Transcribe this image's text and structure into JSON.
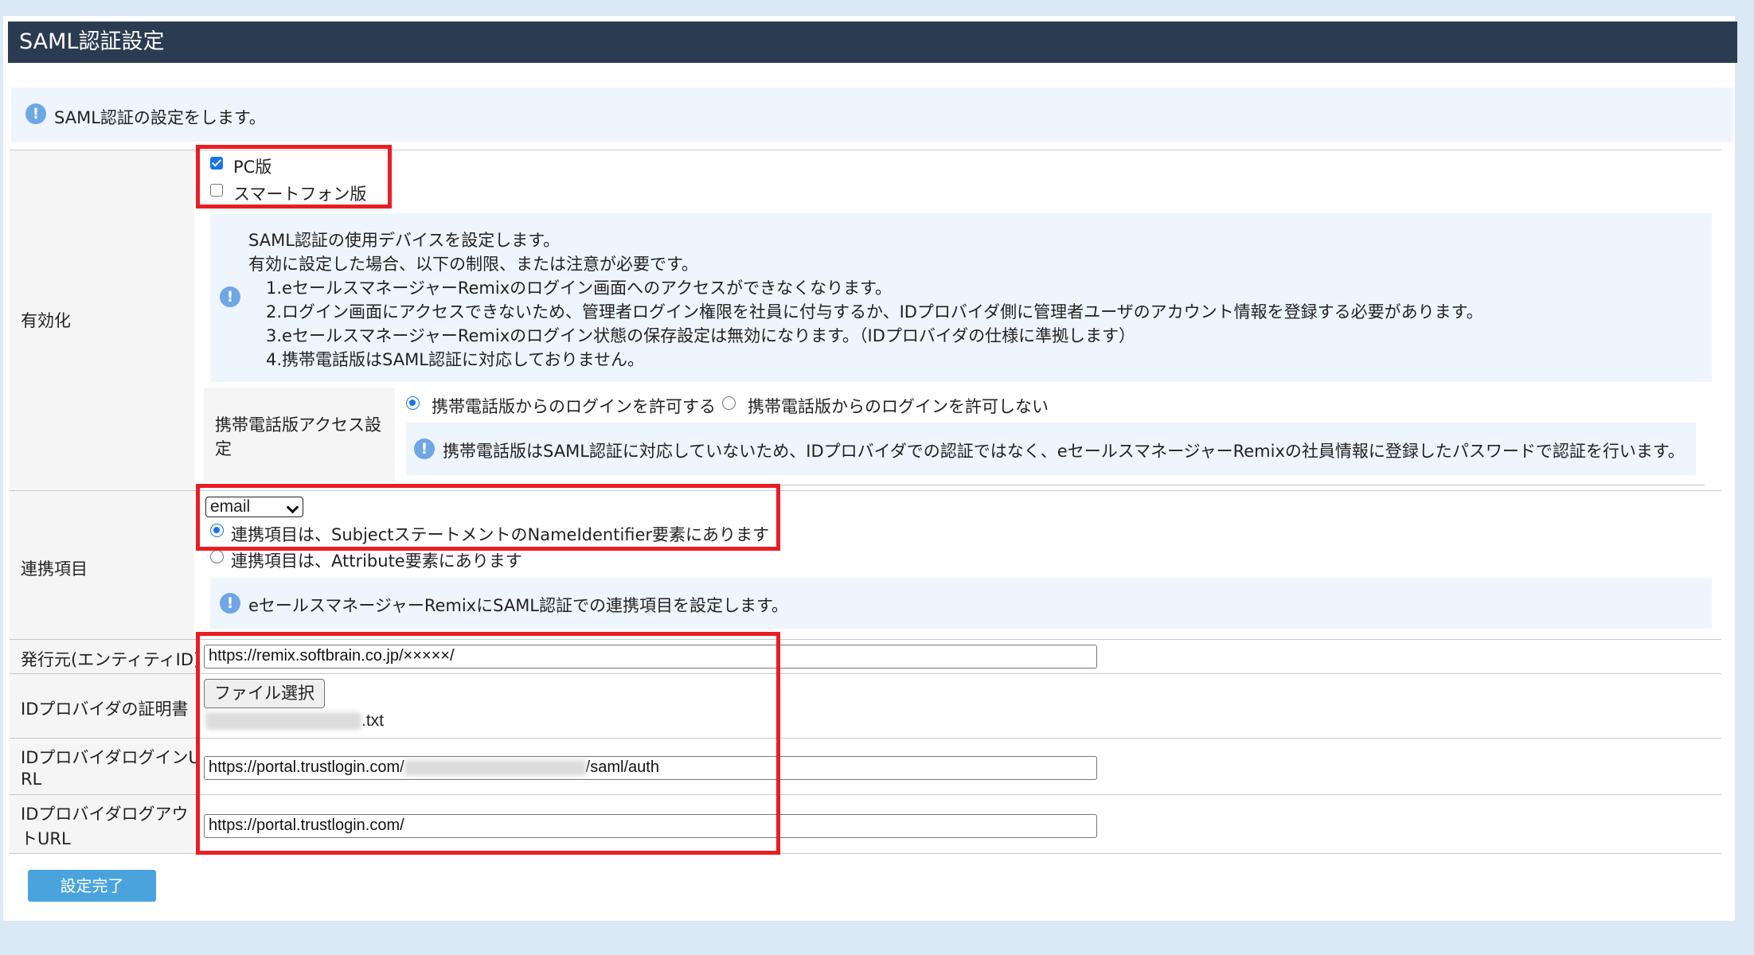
{
  "page": {
    "title": "SAML認証設定",
    "intro": "SAML認証の設定をします。"
  },
  "enable": {
    "label": "有効化",
    "pc": {
      "label": "PC版",
      "checked": true
    },
    "smartphone": {
      "label": "スマートフォン版",
      "checked": false
    },
    "note_lines": [
      "SAML認証の使用デバイスを設定します。",
      "有効に設定した場合、以下の制限、または注意が必要です。",
      "1.eセールスマネージャーRemixのログイン画面へのアクセスができなくなります。",
      "2.ログイン画面にアクセスできないため、管理者ログイン権限を社員に付与するか、IDプロバイダ側に管理者ユーザのアカウント情報を登録する必要があります。",
      "3.eセールスマネージャーRemixのログイン状態の保存設定は無効になります。（IDプロバイダの仕様に準拠します）",
      "4.携帯電話版はSAML認証に対応しておりません。"
    ],
    "mobile_access": {
      "label": "携帯電話版アクセス設定",
      "allow": "携帯電話版からのログインを許可する",
      "deny": "携帯電話版からのログインを許可しない",
      "selected": "allow",
      "note": "携帯電話版はSAML認証に対応していないため、IDプロバイダでの認証ではなく、eセールスマネージャーRemixの社員情報に登録したパスワードで認証を行います。"
    }
  },
  "linkage": {
    "label": "連携項目",
    "select_value": "email",
    "option_subject": "連携項目は、SubjectステートメントのNameIdentifier要素にあります",
    "option_attribute": "連携項目は、Attribute要素にあります",
    "selected": "subject",
    "note": "eセールスマネージャーRemixにSAML認証での連携項目を設定します。"
  },
  "issuer": {
    "label": "発行元(エンティティID)",
    "value": "https://remix.softbrain.co.jp/×××××/"
  },
  "certificate": {
    "label": "IDプロバイダの証明書",
    "button": "ファイル選択",
    "file_suffix": ".txt"
  },
  "login_url": {
    "label_1": "IDプロバイダログインU",
    "label_2": "RL",
    "prefix": "https://portal.trustlogin.com/",
    "suffix": "/saml/auth"
  },
  "logout_url": {
    "label_1": "IDプロバイダログアウ",
    "label_2": "トURL",
    "value": "https://portal.trustlogin.com/"
  },
  "submit_label": "設定完了",
  "colors": {
    "title_bar": "#2b3c52",
    "info_bg": "#eef5fd",
    "highlight": "#ea1c24",
    "submit": "#4aa3dc"
  }
}
